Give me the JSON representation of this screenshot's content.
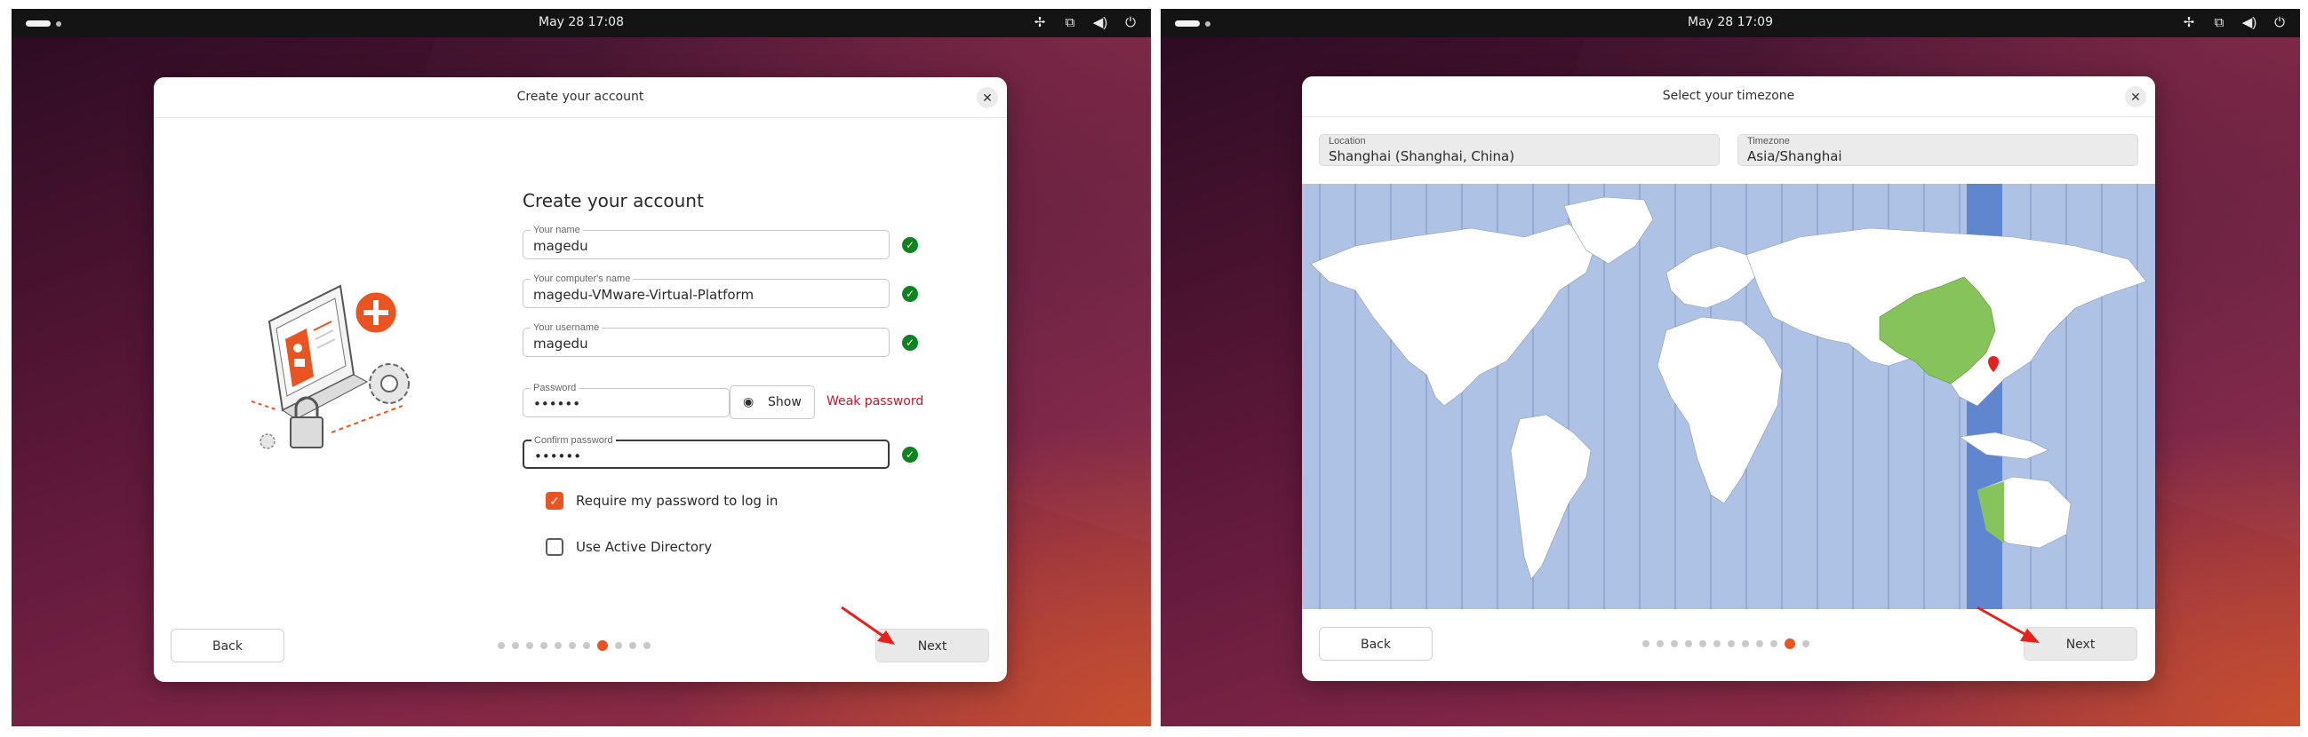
{
  "screens": [
    {
      "topbar": {
        "clock": "May 28  17:08"
      },
      "dialog": {
        "title": "Create your account",
        "heading": "Create your account",
        "fields": {
          "name": {
            "label": "Your name",
            "value": "magedu"
          },
          "computer": {
            "label": "Your computer's name",
            "value": "magedu-VMware-Virtual-Platform"
          },
          "username": {
            "label": "Your username",
            "value": "magedu"
          },
          "password": {
            "label": "Password",
            "value": "••••••"
          },
          "confirm": {
            "label": "Confirm password",
            "value": "••••••"
          }
        },
        "show_label": "Show",
        "password_strength": "Weak password",
        "require_password": {
          "label": "Require my password to log in",
          "checked": true
        },
        "active_directory": {
          "label": "Use Active Directory",
          "checked": false
        },
        "back_label": "Back",
        "next_label": "Next",
        "steps": {
          "total": 11,
          "active": 8
        }
      }
    },
    {
      "topbar": {
        "clock": "May 28  17:09"
      },
      "dialog": {
        "title": "Select your timezone",
        "location": {
          "label": "Location",
          "value": "Shanghai (Shanghai, China)"
        },
        "timezone": {
          "label": "Timezone",
          "value": "Asia/Shanghai"
        },
        "back_label": "Back",
        "next_label": "Next",
        "steps": {
          "total": 12,
          "active": 11
        }
      }
    }
  ],
  "colors": {
    "accent": "#e95420",
    "ok_green": "#0e8420",
    "error_red": "#c7162b",
    "map_ocean": "#aec2e6",
    "selected_zone": "#5f86cf",
    "selected_country": "#86c45b"
  },
  "icons": {
    "topbar": [
      "accessibility-icon",
      "network-icon",
      "volume-icon",
      "power-icon"
    ],
    "close": "close-icon",
    "field_ok": "check-circle-icon",
    "show": "eye-icon"
  }
}
